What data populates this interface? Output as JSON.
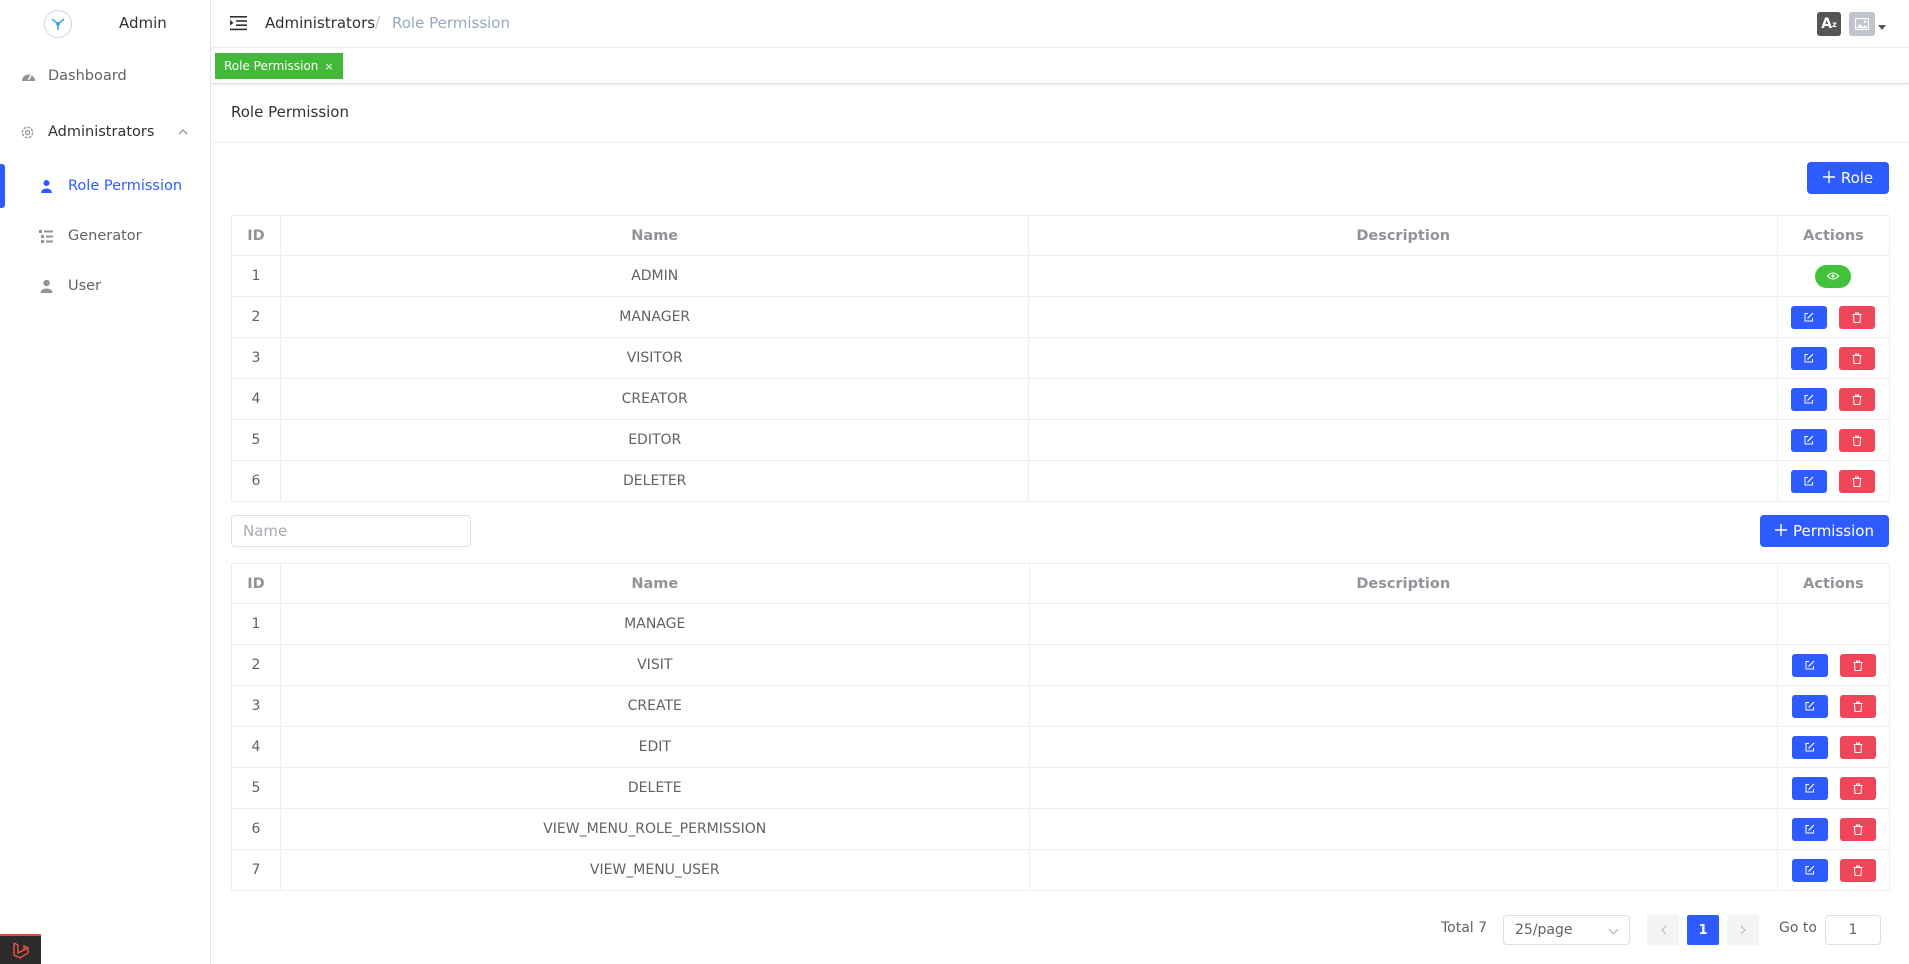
{
  "brand": {
    "name": "Admin"
  },
  "sidebar": {
    "items": [
      {
        "label": "Dashboard",
        "icon": "dashboard-icon"
      },
      {
        "label": "Administrators",
        "icon": "gear-icon"
      },
      {
        "label": "Role Permission",
        "icon": "role-icon"
      },
      {
        "label": "Generator",
        "icon": "generator-icon"
      },
      {
        "label": "User",
        "icon": "user-icon"
      }
    ]
  },
  "header": {
    "breadcrumb": [
      "Administrators",
      "/",
      "Role Permission"
    ],
    "lang_label": "A"
  },
  "tags": {
    "active": "Role Permission",
    "close": "×"
  },
  "card": {
    "title": "Role Permission"
  },
  "roles": {
    "add_button": "Role",
    "columns": [
      "ID",
      "Name",
      "Description",
      "Actions"
    ],
    "rows": [
      {
        "id": "1",
        "name": "ADMIN",
        "description": ""
      },
      {
        "id": "2",
        "name": "MANAGER",
        "description": ""
      },
      {
        "id": "3",
        "name": "VISITOR",
        "description": ""
      },
      {
        "id": "4",
        "name": "CREATOR",
        "description": ""
      },
      {
        "id": "5",
        "name": "EDITOR",
        "description": ""
      },
      {
        "id": "6",
        "name": "DELETER",
        "description": ""
      }
    ]
  },
  "permissions": {
    "search_placeholder": "Name",
    "add_button": "Permission",
    "columns": [
      "ID",
      "Name",
      "Description",
      "Actions"
    ],
    "rows": [
      {
        "id": "1",
        "name": "MANAGE",
        "description": ""
      },
      {
        "id": "2",
        "name": "VISIT",
        "description": ""
      },
      {
        "id": "3",
        "name": "CREATE",
        "description": ""
      },
      {
        "id": "4",
        "name": "EDIT",
        "description": ""
      },
      {
        "id": "5",
        "name": "DELETE",
        "description": ""
      },
      {
        "id": "6",
        "name": "VIEW_MENU_ROLE_PERMISSION",
        "description": ""
      },
      {
        "id": "7",
        "name": "VIEW_MENU_USER",
        "description": ""
      }
    ]
  },
  "pagination": {
    "total": "Total 7",
    "page_size": "25/page",
    "current_page": "1",
    "goto_label": "Go to",
    "goto_value": "1"
  },
  "colors": {
    "primary": "#2d5bff",
    "danger": "#f0465a",
    "success": "#42b938"
  }
}
